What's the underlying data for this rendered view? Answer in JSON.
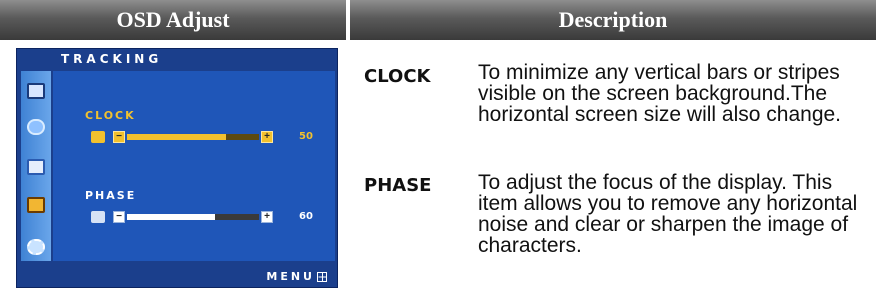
{
  "header": {
    "left_title": "OSD Adjust",
    "right_title": "Description"
  },
  "osd": {
    "title": "TRACKING",
    "footer_label": "MENU",
    "colors": {
      "panel": "#1f56b8",
      "sidebar": "#4f91de",
      "highlight": "#f2c12e"
    },
    "sidebar_icons": [
      "monitor-icon",
      "color-icon",
      "picture-icon",
      "tracking-icon",
      "setup-icon"
    ],
    "settings": [
      {
        "label": "CLOCK",
        "value": "50",
        "level": 0.75
      },
      {
        "label": "PHASE",
        "value": "60",
        "level": 0.67
      }
    ]
  },
  "descriptions": [
    {
      "term": "CLOCK",
      "text": "To minimize any vertical bars or stripes visible on the screen background.The horizontal screen size will also change."
    },
    {
      "term": "PHASE",
      "text": "To adjust the focus of the display. This item allows you to remove any horizontal noise and clear or sharpen the image of characters."
    }
  ]
}
